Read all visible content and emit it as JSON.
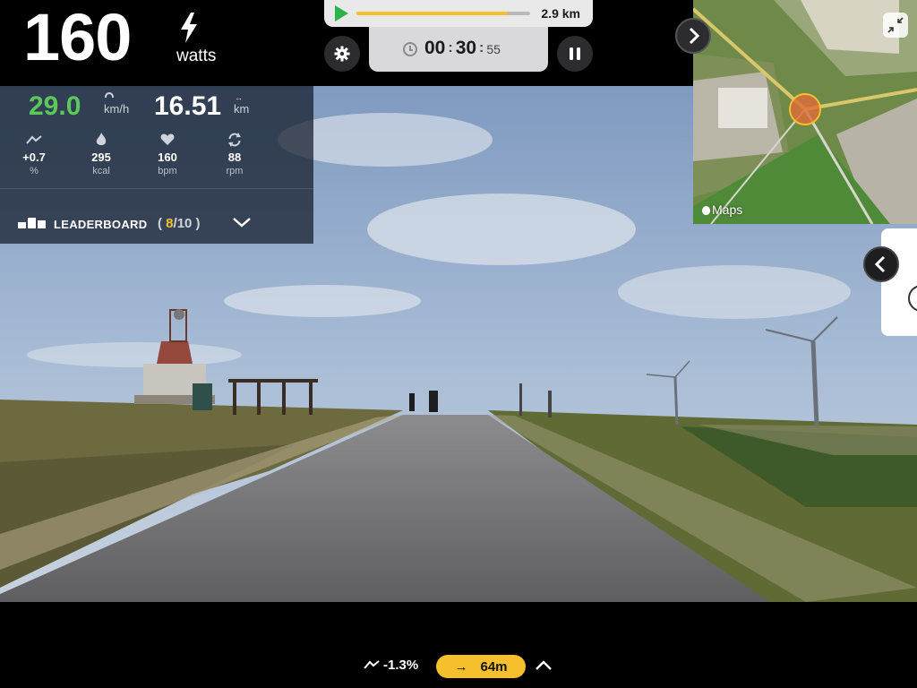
{
  "power": {
    "value": "160",
    "unit": "watts",
    "icon": "bolt-icon"
  },
  "route": {
    "progress_fraction": 0.87,
    "distance": "2.9 km",
    "progress_color": "#f5c02b"
  },
  "timer": {
    "hours": "00",
    "minutes": "30",
    "seconds": "55"
  },
  "hud": {
    "speed": {
      "value": "29.0",
      "unit": "km/h",
      "color": "#5cc85b"
    },
    "distance": {
      "value": "16.51",
      "unit": "km"
    },
    "stats": [
      {
        "icon": "grade-icon",
        "value": "+0.7",
        "unit": "%"
      },
      {
        "icon": "flame-icon",
        "value": "295",
        "unit": "kcal"
      },
      {
        "icon": "heart-icon",
        "value": "160",
        "unit": "bpm"
      },
      {
        "icon": "cadence-icon",
        "value": "88",
        "unit": "rpm"
      }
    ]
  },
  "leaderboard": {
    "label": "LEADERBOARD",
    "position": "8",
    "total": "10"
  },
  "map": {
    "label": "Maps"
  },
  "bottom": {
    "grade": "-1.3%",
    "turn_distance": "64m"
  }
}
